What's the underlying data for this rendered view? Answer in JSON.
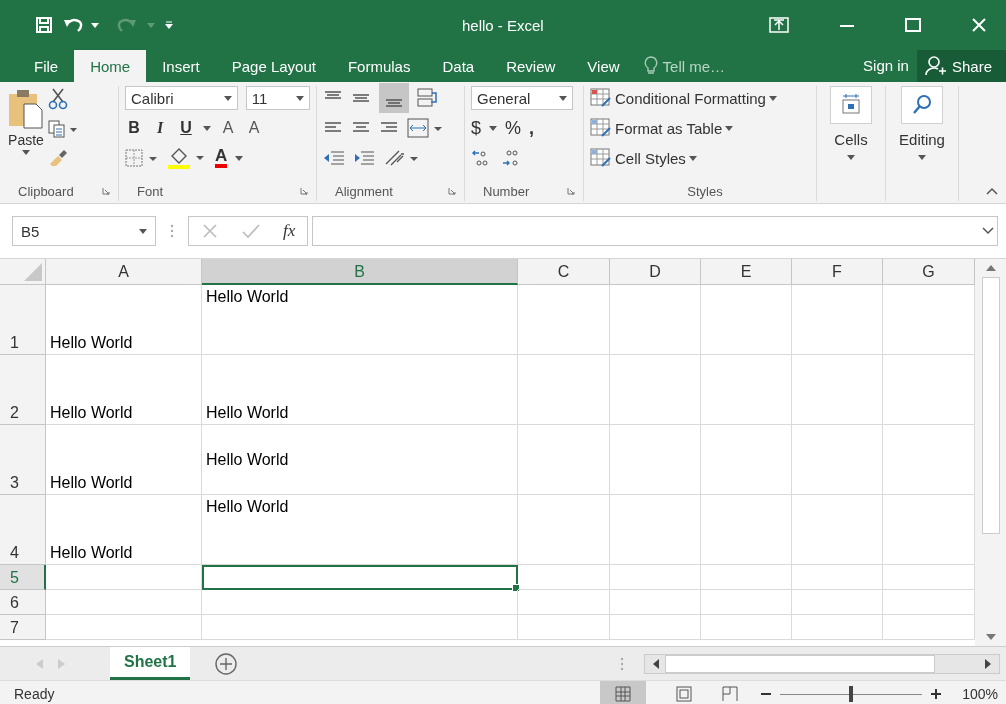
{
  "window": {
    "title": "hello - Excel"
  },
  "menu_tabs": [
    {
      "label": "File",
      "selected": false
    },
    {
      "label": "Home",
      "selected": true
    },
    {
      "label": "Insert",
      "selected": false
    },
    {
      "label": "Page Layout",
      "selected": false
    },
    {
      "label": "Formulas",
      "selected": false
    },
    {
      "label": "Data",
      "selected": false
    },
    {
      "label": "Review",
      "selected": false
    },
    {
      "label": "View",
      "selected": false
    }
  ],
  "tell_me": "Tell me…",
  "sign_in": "Sign in",
  "share": "Share",
  "ribbon": {
    "paste": "Paste",
    "font_name": "Calibri",
    "font_size": "11",
    "format_buttons": [
      "B",
      "I",
      "U"
    ],
    "size_buttons": [
      "A",
      "A"
    ],
    "font_color": "A",
    "number_format": "General",
    "number_buttons": [
      "$",
      "%",
      ","
    ],
    "styles": [
      "Conditional Formatting",
      "Format as Table",
      "Cell Styles"
    ],
    "cells": "Cells",
    "editing": "Editing",
    "groups": [
      "Clipboard",
      "Font",
      "Alignment",
      "Number",
      "Styles"
    ]
  },
  "formula_bar": {
    "name_box": "B5",
    "fx": "fx"
  },
  "columns": [
    {
      "label": "A",
      "selected": false
    },
    {
      "label": "B",
      "selected": true
    },
    {
      "label": "C",
      "selected": false
    },
    {
      "label": "D",
      "selected": false
    },
    {
      "label": "E",
      "selected": false
    },
    {
      "label": "F",
      "selected": false
    },
    {
      "label": "G",
      "selected": false
    }
  ],
  "rows": [
    {
      "label": "1",
      "kind": "tall",
      "selected": false,
      "cells": [
        {
          "text": "Hello World",
          "kind": "bottom"
        },
        {
          "text": "Hello World",
          "kind": "top"
        }
      ]
    },
    {
      "label": "2",
      "kind": "tall",
      "selected": false,
      "cells": [
        {
          "text": "Hello World",
          "kind": "bottom"
        },
        {
          "text": "Hello World",
          "kind": "bottom"
        }
      ]
    },
    {
      "label": "3",
      "kind": "tall",
      "selected": false,
      "cells": [
        {
          "text": "Hello World",
          "kind": "bottom"
        },
        {
          "text": "Hello World",
          "kind": "middle"
        }
      ]
    },
    {
      "label": "4",
      "kind": "tall",
      "selected": false,
      "cells": [
        {
          "text": "Hello World",
          "kind": "bottom"
        },
        {
          "text": "Hello World",
          "kind": "top"
        }
      ]
    },
    {
      "label": "5",
      "kind": "normal",
      "selected": true,
      "cells": []
    },
    {
      "label": "6",
      "kind": "normal",
      "selected": false,
      "cells": []
    },
    {
      "label": "7",
      "kind": "normal",
      "selected": false,
      "cells": []
    }
  ],
  "sheets": [
    {
      "label": "Sheet1",
      "selected": true
    }
  ],
  "status_bar": {
    "text": "Ready",
    "zoom": "100%",
    "zoom_slider": {
      "level": 0.5
    }
  }
}
